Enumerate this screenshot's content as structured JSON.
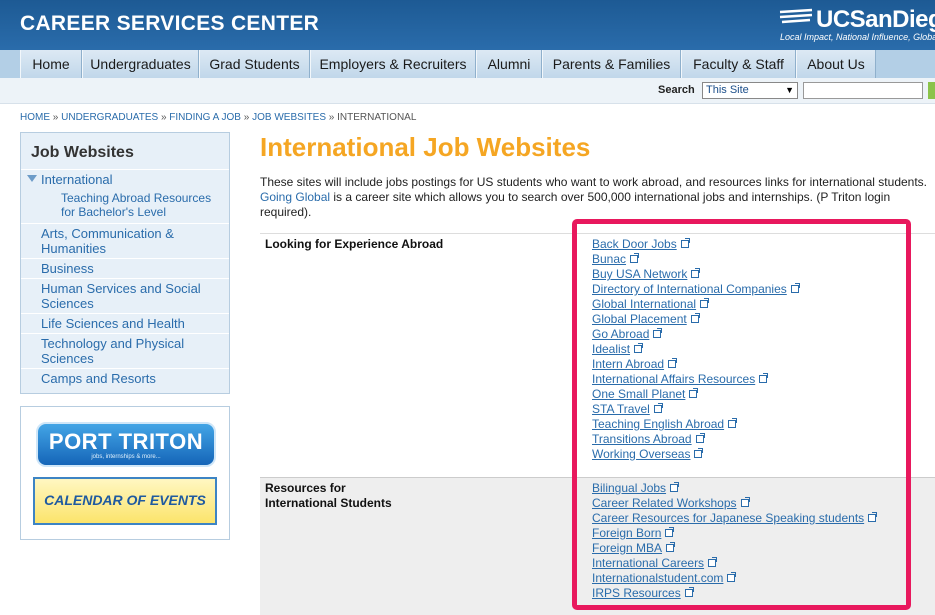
{
  "header": {
    "title": "CAREER SERVICES CENTER",
    "logo_text": "UCSanDiego",
    "logo_tagline": "Local Impact, National Influence, Global Reach"
  },
  "nav": [
    "Home",
    "Undergraduates",
    "Grad Students",
    "Employers & Recruiters",
    "Alumni",
    "Parents & Families",
    "Faculty & Staff",
    "About Us"
  ],
  "search": {
    "label": "Search",
    "scope": "This Site",
    "value": ""
  },
  "breadcrumb": [
    "HOME",
    "UNDERGRADUATES",
    "FINDING A JOB",
    "JOB WEBSITES",
    "INTERNATIONAL"
  ],
  "sidebar": {
    "title": "Job Websites",
    "active": "International",
    "sub": "Teaching Abroad Resources for Bachelor's Level",
    "items": [
      "Arts, Communication & Humanities",
      "Business",
      "Human Services and Social Sciences",
      "Life Sciences and Health",
      "Technology and Physical Sciences",
      "Camps and Resorts"
    ]
  },
  "promo": {
    "port_triton": "PORT TRITON",
    "port_tag": "jobs, internships & more...",
    "calendar": "CALENDAR OF EVENTS"
  },
  "main": {
    "title": "International Job Websites",
    "intro_1": "These sites will include jobs postings for US students who want to work abroad, and resources links for international students. ",
    "intro_link": "Going Global",
    "intro_2": " is a career site which allows you to search over 500,000 international jobs and internships. (P Triton login required).",
    "sections": [
      {
        "label": "Looking for Experience Abroad",
        "links": [
          "Back Door Jobs",
          "Bunac",
          "Buy USA Network",
          "Directory of International Companies",
          "Global International",
          "Global Placement",
          "Go Abroad",
          "Idealist",
          "Intern Abroad",
          "International Affairs Resources",
          "One Small Planet",
          "STA Travel",
          "Teaching English Abroad",
          "Transitions Abroad",
          "Working Overseas"
        ]
      },
      {
        "label": "Resources for International Students",
        "links": [
          "Bilingual Jobs",
          "Career Related Workshops",
          "Career Resources for Japanese Speaking students",
          "Foreign Born",
          "Foreign MBA",
          "International Careers",
          "Internationalstudent.com",
          "IRPS Resources"
        ]
      }
    ]
  },
  "colors": {
    "header": "#2a6cab",
    "title": "#f5a623",
    "link": "#2a6cab",
    "highlight": "#e8185d"
  }
}
